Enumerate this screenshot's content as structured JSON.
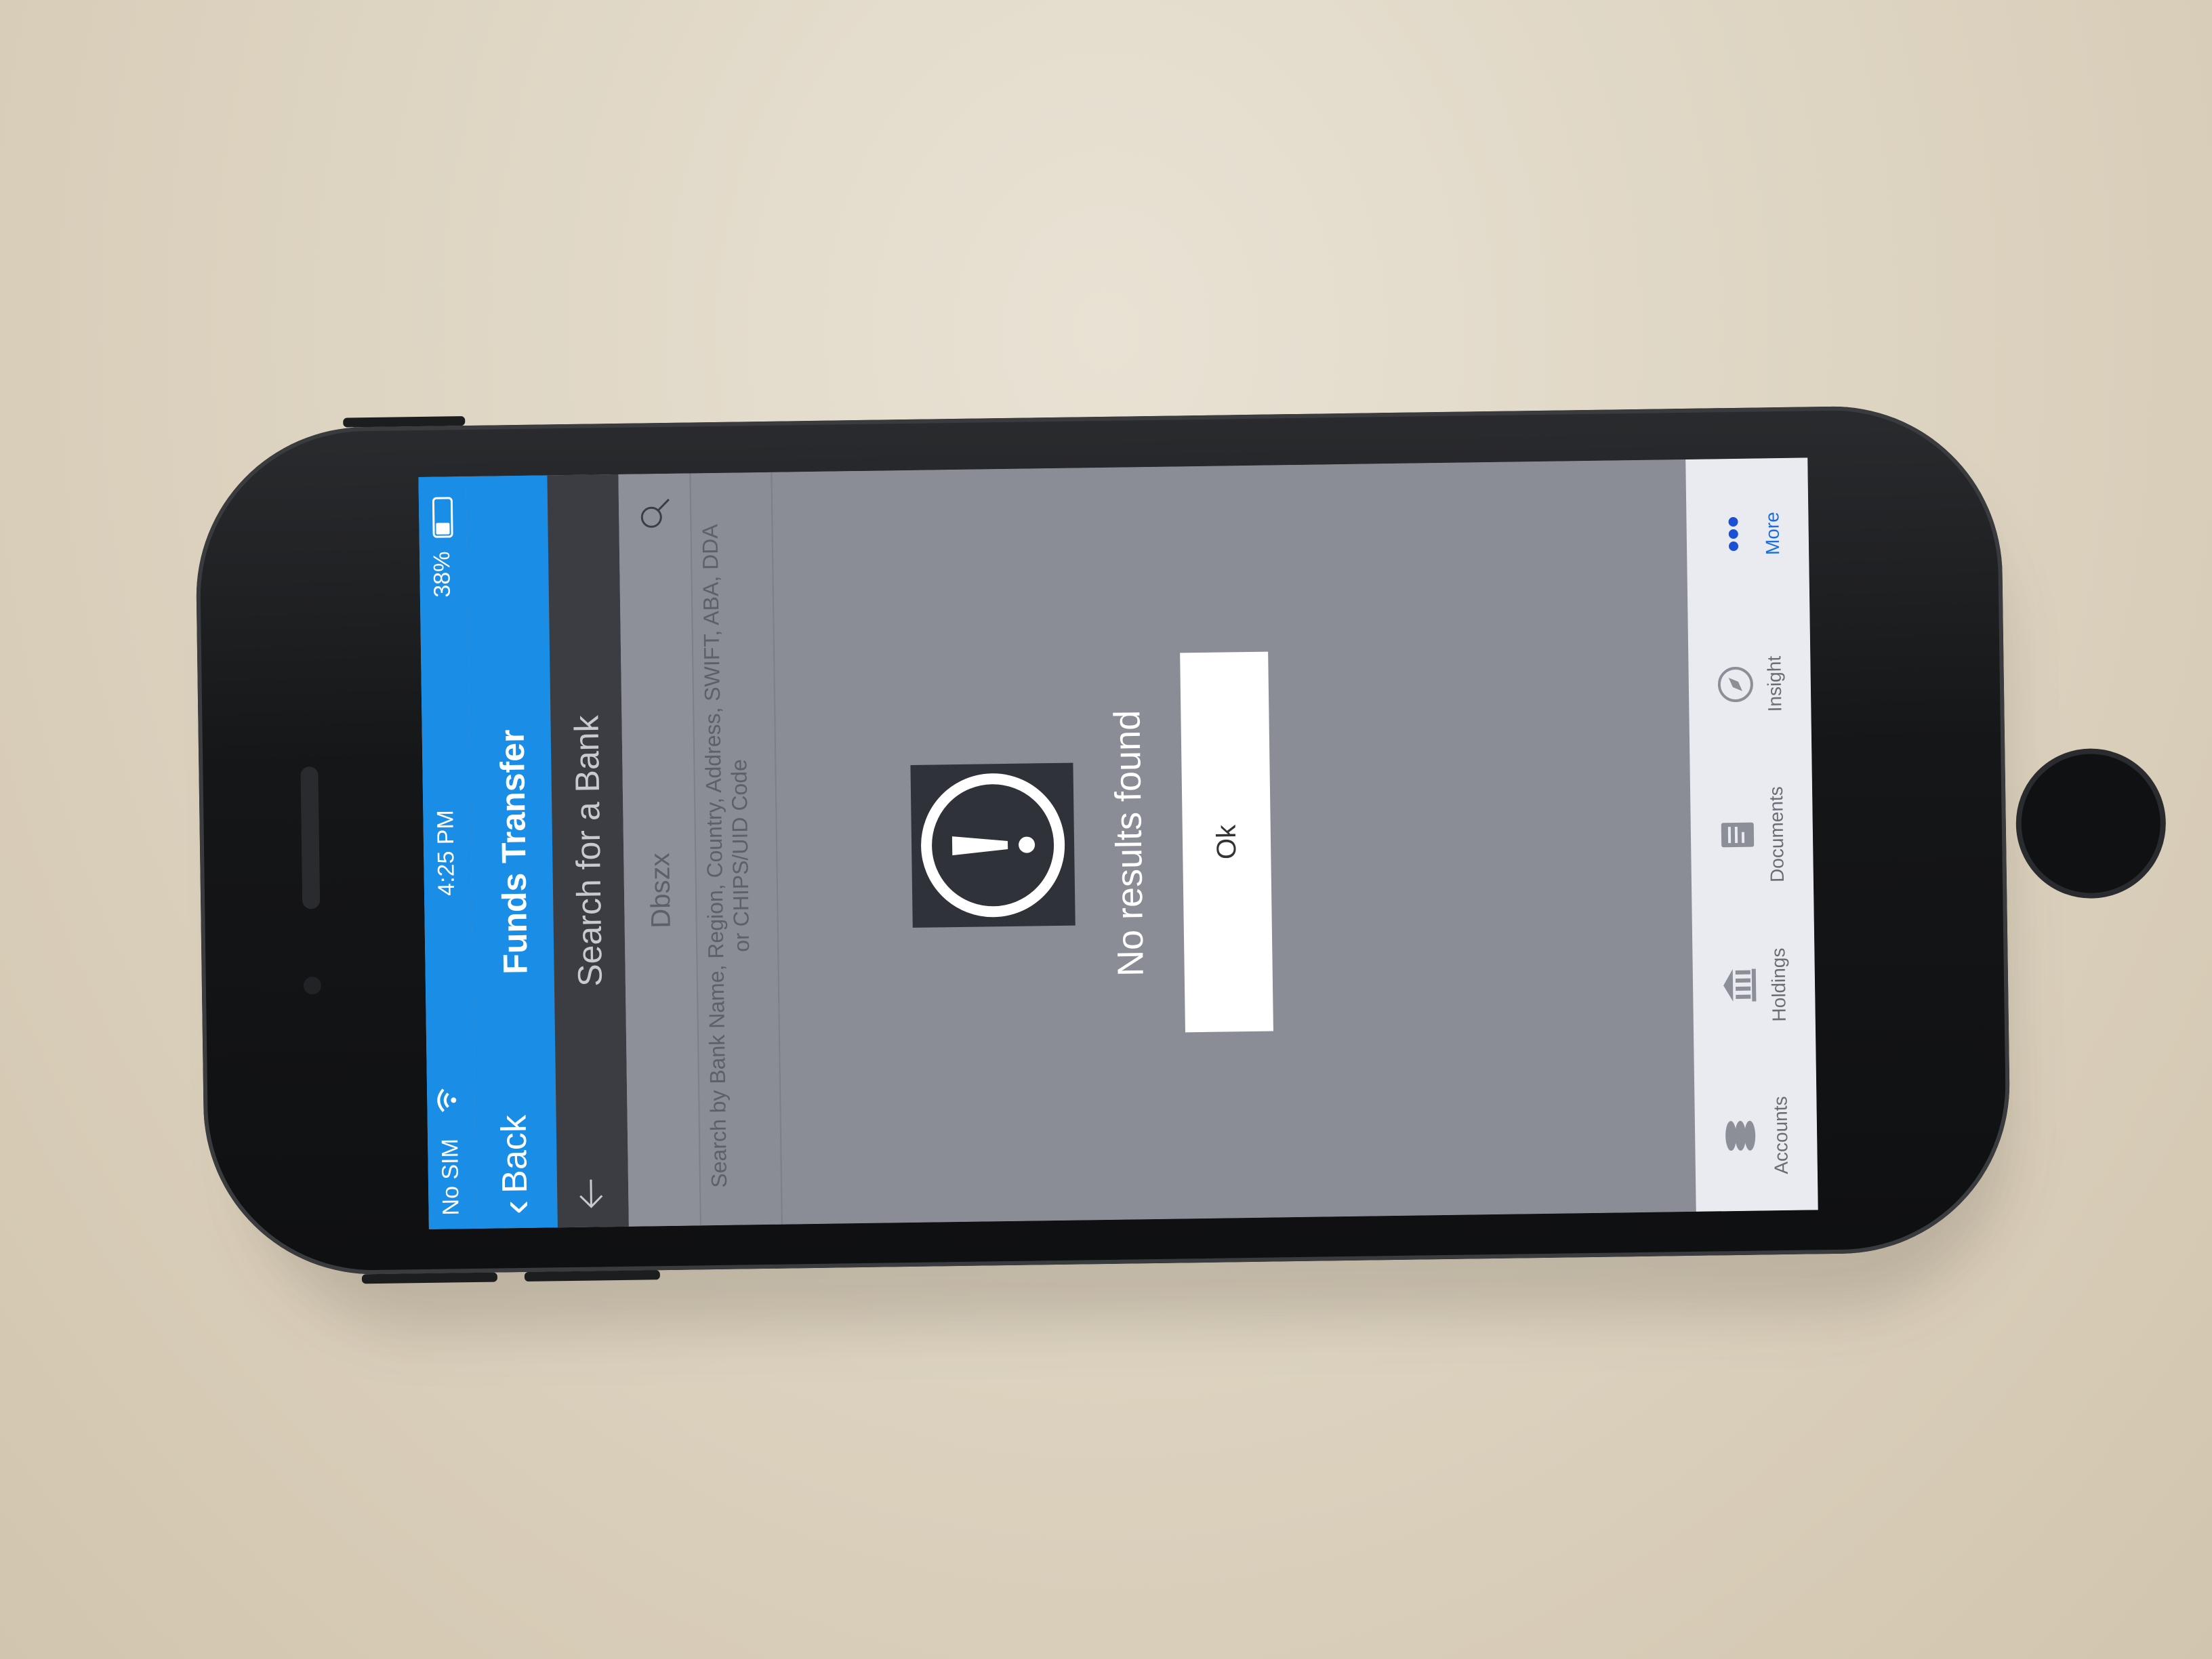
{
  "status_bar": {
    "carrier": "No SIM",
    "time": "4:25 PM",
    "battery_percent": "38%",
    "battery_level": 0.38
  },
  "nav": {
    "back_label": "Back",
    "title": "Funds Transfer"
  },
  "search": {
    "heading": "Search for a Bank",
    "value": "Dbszx",
    "helper_text": "Search by Bank Name, Region, Country, Address, SWIFT, ABA, DDA or CHIPS/UID Code"
  },
  "dialog": {
    "message": "No results found",
    "ok_label": "Ok"
  },
  "tab_bar": {
    "tabs": [
      {
        "label": "Accounts",
        "icon": "coins-icon"
      },
      {
        "label": "Holdings",
        "icon": "bank-icon"
      },
      {
        "label": "Documents",
        "icon": "document-icon"
      },
      {
        "label": "Insight",
        "icon": "compass-icon"
      },
      {
        "label": "More",
        "icon": "more-dots-icon"
      }
    ],
    "active": "More"
  },
  "colors": {
    "header_blue": "#1a8de6",
    "overlay_gray": "#8a8d96",
    "active_tab": "#1b6fd6"
  }
}
